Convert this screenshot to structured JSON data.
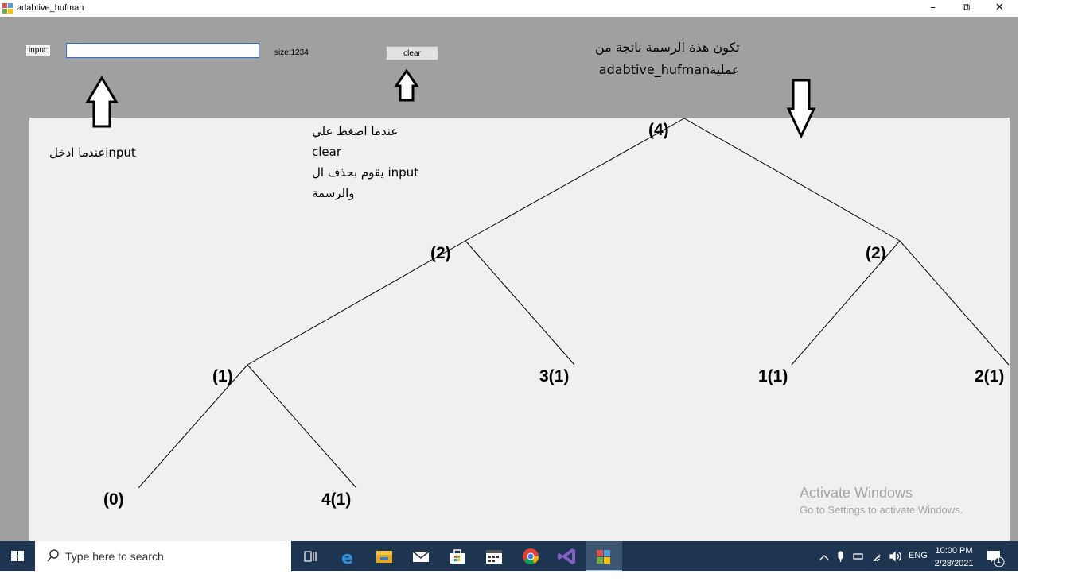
{
  "window": {
    "title": "adabtive_hufman",
    "minimize": "–",
    "restore": "⧉",
    "close": "✕"
  },
  "form": {
    "input_label": "input:",
    "input_value": "",
    "size_label": "size:1234",
    "clear_label": "clear"
  },
  "annotations": {
    "input_note": "عندما ادخلinput",
    "clear_note": [
      "عندما اضغط علي",
      "clear",
      "يقوم بحذف ال input",
      "والرسمة"
    ],
    "tree_note": [
      "تكون هذة الرسمة ناتجة من",
      "adabtive_hufmanعملية"
    ]
  },
  "tree": {
    "root": "(4)",
    "left": "(2)",
    "right": "(2)",
    "left_left": "(1)",
    "left_right": "3(1)",
    "right_left": "1(1)",
    "right_right": "2(1)",
    "leaf_nyt": "(0)",
    "leaf_4": "4(1)"
  },
  "watermark": {
    "line1": "Activate Windows",
    "line2": "Go to Settings to activate Windows."
  },
  "taskbar": {
    "search_placeholder": "Type here to search",
    "language": "ENG",
    "time": "10:00 PM",
    "date": "2/28/2021",
    "notification_count": "1",
    "icons": [
      "task-view-icon",
      "edge-icon",
      "file-explorer-icon",
      "mail-icon",
      "store-icon",
      "calendar-icon",
      "chrome-icon",
      "visual-studio-icon",
      "winforms-app-icon"
    ],
    "colors": {
      "bar": "#1e3551",
      "active": "#3c5573"
    }
  }
}
